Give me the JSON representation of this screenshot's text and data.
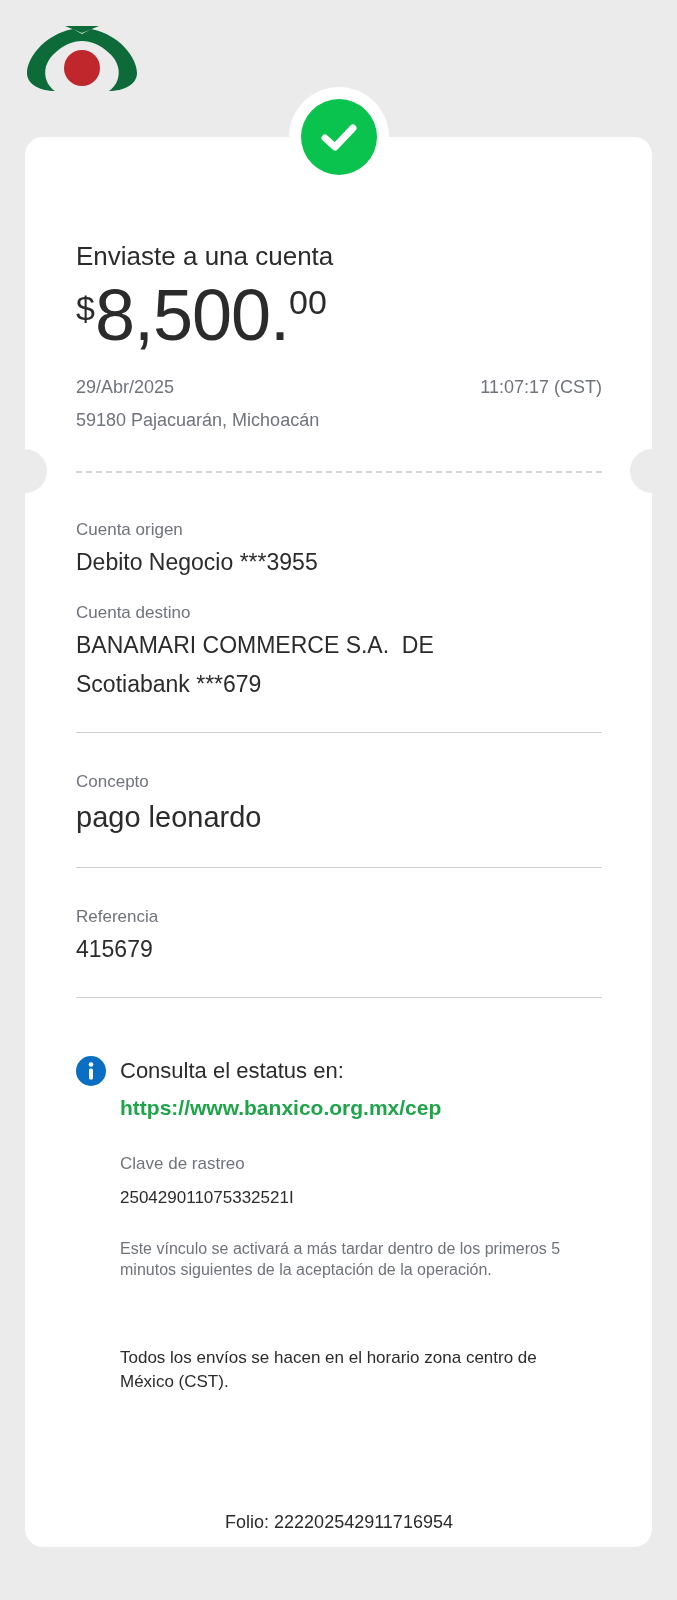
{
  "header": {
    "title": "Enviaste a una cuenta",
    "currency": "$",
    "amount": "8,500.",
    "cents": "00",
    "date": "29/Abr/2025",
    "time": "11:07:17 (CST)",
    "location": "59180 Pajacuarán, Michoacán"
  },
  "groups": [
    {
      "fields": [
        {
          "label": "Cuenta origen",
          "kind": "normal",
          "lines": [
            "Debito Negocio ***3955"
          ]
        },
        {
          "label": "Cuenta destino",
          "kind": "normal",
          "lines": [
            "BANAMARI COMMERCE S.A.  DE",
            "Scotiabank ***679"
          ]
        }
      ]
    },
    {
      "fields": [
        {
          "label": "Concepto",
          "kind": "large",
          "lines": [
            "pago leonardo"
          ]
        }
      ]
    },
    {
      "fields": [
        {
          "label": "Referencia",
          "kind": "normal",
          "lines": [
            "415679"
          ]
        }
      ]
    }
  ],
  "status": {
    "text": "Consulta el estatus en:",
    "link": "https://www.banxico.org.mx/cep",
    "tracking_label": "Clave de rastreo",
    "tracking_value": "250429011075332521I",
    "note": "Este vínculo se activará a más tardar dentro de los primeros 5 minutos siguientes de la aceptación de la operación."
  },
  "timezone_note": "Todos los envíos se hacen en el horario zona centro de México (CST).",
  "folio": "Folio: 222202542911716954"
}
